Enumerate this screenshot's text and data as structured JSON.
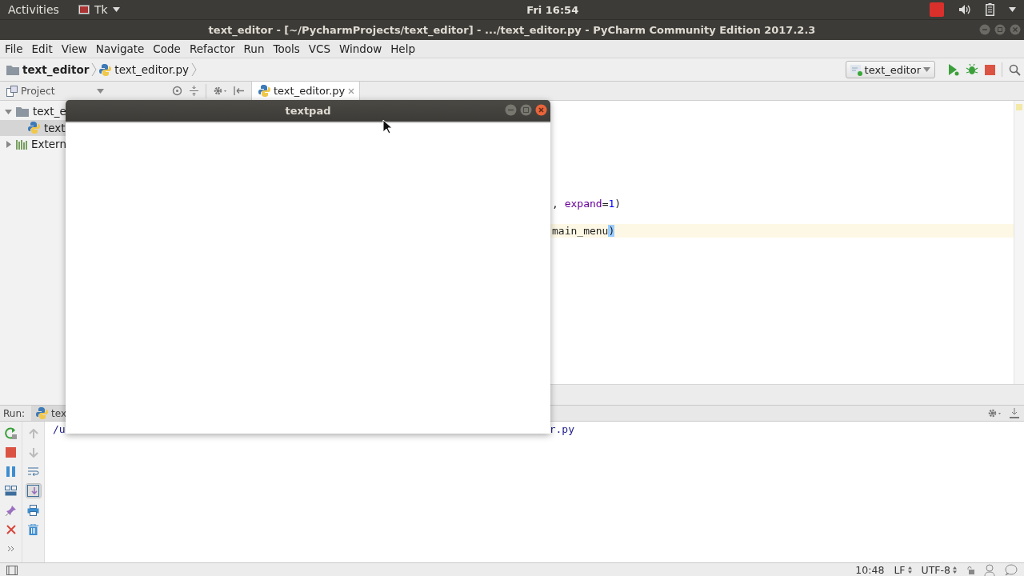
{
  "top_bar": {
    "activities": "Activities",
    "app_menu": "Tk",
    "clock": "Fri 16:54"
  },
  "window": {
    "title": "text_editor - [~/PycharmProjects/text_editor] - .../text_editor.py - PyCharm Community Edition 2017.2.3"
  },
  "menu": [
    "File",
    "Edit",
    "View",
    "Navigate",
    "Code",
    "Refactor",
    "Run",
    "Tools",
    "VCS",
    "Window",
    "Help"
  ],
  "breadcrumbs": [
    {
      "label": "text_editor",
      "kind": "folder"
    },
    {
      "label": "text_editor.py",
      "kind": "python"
    }
  ],
  "run_config": "text_editor",
  "project_panel": {
    "title": "Project",
    "tree": [
      {
        "label": "text_e",
        "kind": "folder",
        "expanded": true,
        "selected": false,
        "children": [
          {
            "label": "text",
            "kind": "python",
            "selected": true
          }
        ]
      },
      {
        "label": "Extern",
        "kind": "library",
        "expanded": false,
        "selected": false
      }
    ]
  },
  "editor_tabs": [
    {
      "label": "text_editor.py",
      "selected": true
    }
  ],
  "code_lines": [
    {
      "current": false,
      "segments": [
        {
          "text": ", ",
          "kind": "plain"
        },
        {
          "text": "expand",
          "kind": "kwarg"
        },
        {
          "text": "=",
          "kind": "plain"
        },
        {
          "text": "1",
          "kind": "number"
        },
        {
          "text": ")",
          "kind": "plain"
        }
      ]
    },
    {
      "current": true,
      "segments": [
        {
          "text": "main_menu",
          "kind": "plain"
        },
        {
          "text": ")",
          "kind": "brace-match"
        }
      ]
    }
  ],
  "dialog": {
    "title": "textpad"
  },
  "run_panel": {
    "label": "Run:",
    "tabs": [
      {
        "label": "tex",
        "selected": true
      }
    ],
    "console": [
      "/u",
      "r.py"
    ]
  },
  "status_bar": {
    "position": "10:48",
    "line_separator": "LF",
    "encoding": "UTF-8"
  }
}
